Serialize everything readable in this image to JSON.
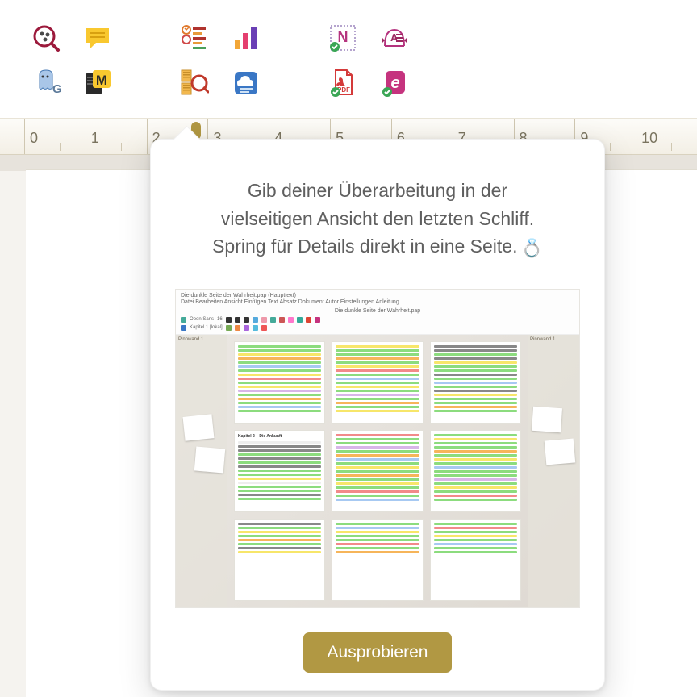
{
  "toolbar": {
    "row1": [
      {
        "name": "find-replace-icon"
      },
      {
        "name": "comment-icon"
      },
      {
        "name": "outline-icon"
      },
      {
        "name": "statistics-icon"
      },
      {
        "name": "word-count-icon"
      },
      {
        "name": "thesaurus-icon"
      }
    ],
    "row2": [
      {
        "name": "ghost-icon"
      },
      {
        "name": "highlight-mode-icon"
      },
      {
        "name": "multipage-view-icon"
      },
      {
        "name": "cloud-sync-icon"
      },
      {
        "name": "export-pdf-icon"
      },
      {
        "name": "export-epub-icon"
      }
    ]
  },
  "ruler": {
    "labels": [
      "0",
      "1",
      "2",
      "3",
      "4",
      "5",
      "6",
      "7",
      "8",
      "9",
      "10"
    ]
  },
  "popover": {
    "line1": "Gib deiner Überarbeitung in der",
    "line2": "vielseitigen Ansicht den letzten Schliff.",
    "line3": "Spring für Details direkt in eine Seite.",
    "ring_emoji": "💍",
    "button_label": "Ausprobieren",
    "preview": {
      "window_title": "Die dunkle Seite der Wahrheit.pap  (Haupttext)",
      "menu": "Datei  Bearbeiten  Ansicht  Einfügen  Text  Absatz  Dokument  Autor  Einstellungen  Anleitung",
      "doc_title_center": "Die dunkle Seite der Wahrheit.pap",
      "font_name": "Open Sans",
      "font_size": "16",
      "chapter_label": "Kapitel 1 [lokal]",
      "pinboard_left": "Pinnwand 1",
      "pinboard_right": "Pinnwand 1",
      "page2_title": "Kapitel 2 – Die Ankunft"
    }
  }
}
